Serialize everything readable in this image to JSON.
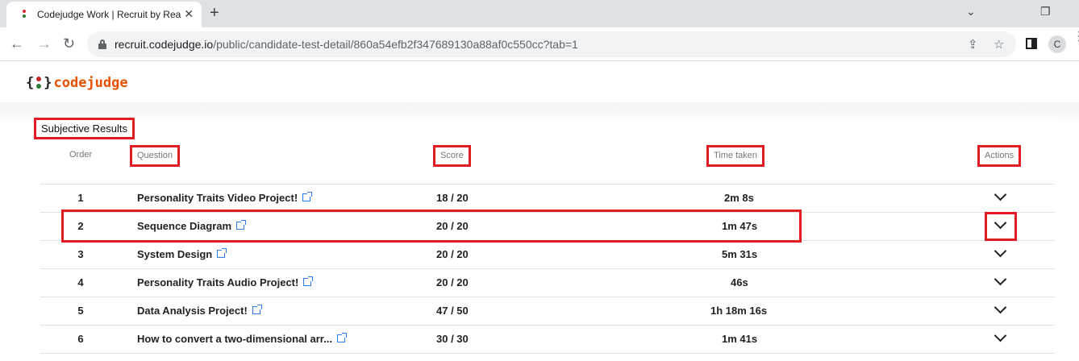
{
  "browser": {
    "tab_title": "Codejudge Work | Recruit by Rea",
    "tab_close": "✕",
    "new_tab": "+",
    "url_host": "recruit.codejudge.io",
    "url_path": "/public/candidate-test-detail/860a54efb2f347689130a88af0c550cc?tab=1",
    "profile_initial": "C",
    "back_icon": "←",
    "forward_icon": "→",
    "reload_icon": "↻",
    "share_icon": "⇪",
    "star_icon": "☆",
    "minimize_icon": "⌄",
    "restore_icon": "❐",
    "menu_icon": "⋮"
  },
  "logo": {
    "left_brace": "{",
    "right_brace": "}",
    "text": "codejudge"
  },
  "section": {
    "title": "Subjective Results"
  },
  "table": {
    "headers": {
      "order": "Order",
      "question": "Question",
      "score": "Score",
      "time_taken": "Time taken",
      "actions": "Actions"
    },
    "rows": [
      {
        "order": "1",
        "question": "Personality Traits Video Project!",
        "score": "18 / 20",
        "time": "2m 8s"
      },
      {
        "order": "2",
        "question": "Sequence Diagram",
        "score": "20 / 20",
        "time": "1m 47s"
      },
      {
        "order": "3",
        "question": "System Design",
        "score": "20 / 20",
        "time": "5m 31s"
      },
      {
        "order": "4",
        "question": "Personality Traits Audio Project!",
        "score": "20 / 20",
        "time": "46s"
      },
      {
        "order": "5",
        "question": "Data Analysis Project!",
        "score": "47 / 50",
        "time": "1h 18m 16s"
      },
      {
        "order": "6",
        "question": "How to convert a two-dimensional arr...",
        "score": "30 / 30",
        "time": "1m 41s"
      }
    ]
  },
  "colors": {
    "highlight": "#e31b23",
    "link_icon": "#2b7de9",
    "logo_text": "#e65100"
  }
}
